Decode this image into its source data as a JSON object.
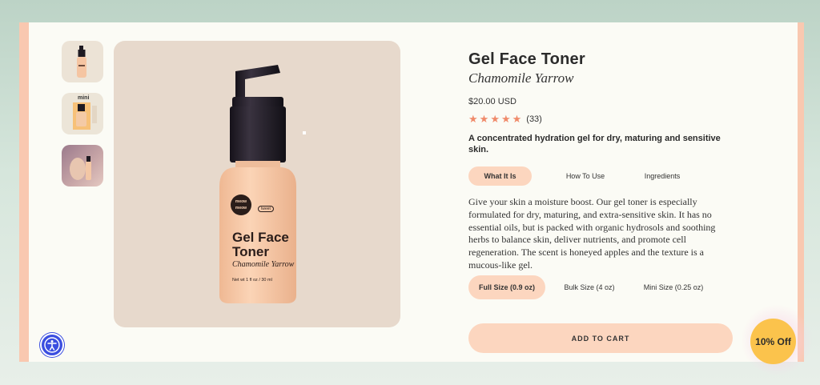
{
  "product": {
    "title": "Gel Face Toner",
    "subtitle": "Chamomile Yarrow",
    "price": "$20.00 USD",
    "rating": 5,
    "review_count": "(33)",
    "tagline": "A concentrated hydration gel for dry, maturing and sensitive skin.",
    "description": "Give your skin a moisture boost. Our gel toner is especially formulated for dry, maturing, and extra-sensitive skin. It has no essential oils, but is packed with organic hydrosols and soothing herbs to balance skin, deliver nutrients, and promote cell regeneration. The scent is honeyed apples and the texture is a mucous-like gel."
  },
  "bottle": {
    "brand_line1": "meow",
    "brand_line2": "meow",
    "badge": "tweet",
    "label_line1": "Gel Face",
    "label_line2": "Toner",
    "label_sub": "Chamomile Yarrow",
    "net": "Net wt 1 fl oz / 30 ml"
  },
  "thumbnails": [
    {
      "label": ""
    },
    {
      "label": "mini"
    },
    {
      "label": ""
    }
  ],
  "tabs": [
    {
      "label": "What It Is",
      "active": true
    },
    {
      "label": "How To Use",
      "active": false
    },
    {
      "label": "Ingredients",
      "active": false
    }
  ],
  "sizes": [
    {
      "label": "Full Size (0.9 oz)",
      "active": true
    },
    {
      "label": "Bulk Size (4 oz)",
      "active": false
    },
    {
      "label": "Mini Size (0.25 oz)",
      "active": false
    }
  ],
  "cart_label": "ADD TO CART",
  "discount_label": "10% Off",
  "colors": {
    "accent": "#fcd6bf",
    "star": "#f08a6a",
    "discount": "#fbc34c",
    "a11y": "#3b4ee0"
  }
}
